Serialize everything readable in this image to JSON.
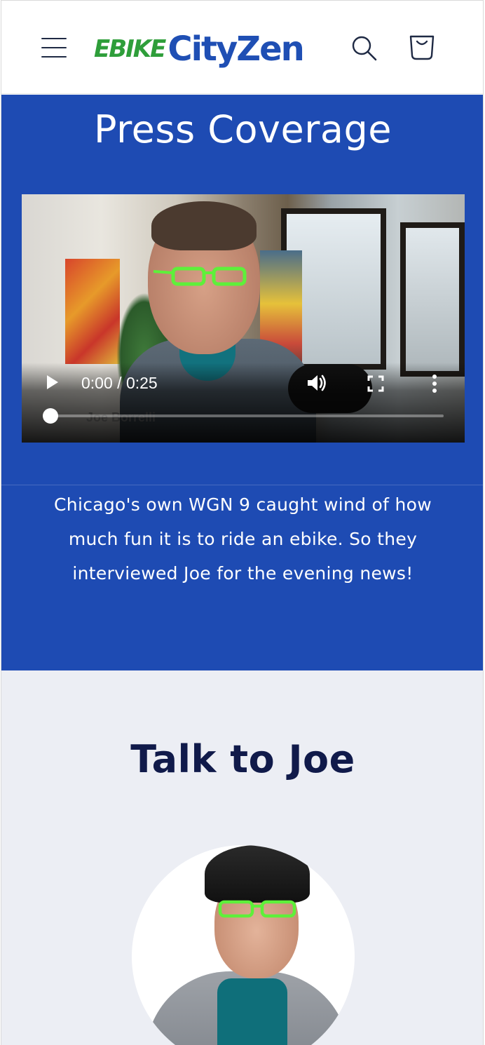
{
  "header": {
    "brand_prefix": "EBIKE",
    "brand_name": "CityZen"
  },
  "press": {
    "title": "Press Coverage",
    "video": {
      "current_time": "0:00",
      "separator": " / ",
      "duration": "0:25",
      "lower_third": "Joe Borrelli",
      "progress": 0
    },
    "description": "Chicago's own WGN 9 caught wind of how much fun it is to ride an ebike. So they interviewed Joe for the evening news!"
  },
  "talk": {
    "title": "Talk to Joe"
  },
  "colors": {
    "brand_green": "#2e9e3a",
    "brand_blue": "#1f4fb4",
    "press_bg": "#1e4bb3",
    "talk_bg": "#eceef4",
    "glasses_green": "#5ef03a"
  },
  "icons": [
    "menu-icon",
    "search-icon",
    "cart-icon",
    "play-icon",
    "volume-icon",
    "fullscreen-icon",
    "more-vert-icon"
  ]
}
